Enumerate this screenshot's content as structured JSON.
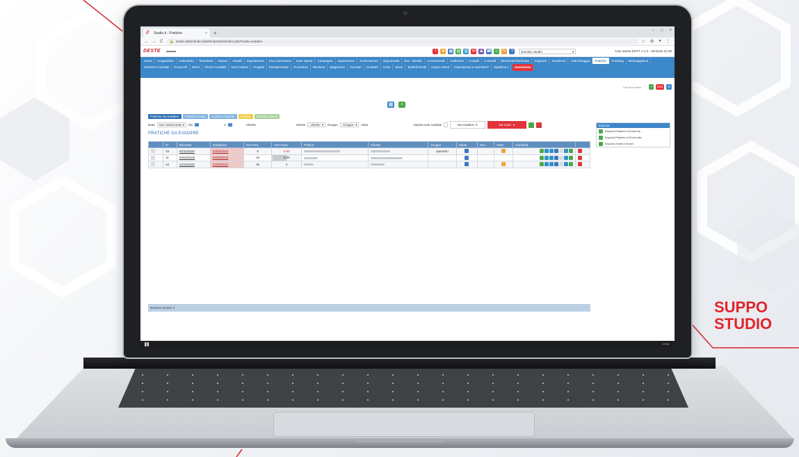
{
  "promo": {
    "text": "SUPPO\nSTUDIO",
    "accent": "#e3242b"
  },
  "browser": {
    "tab_title": "Studio.it - Pratiche",
    "url": "studio.dottorstudio.it/admin/pratiche/index.php?mode=evadere",
    "new_tab": "+",
    "close": "×",
    "window_controls": [
      "–",
      "□",
      "×"
    ],
    "nav": [
      "←",
      "→",
      "C"
    ]
  },
  "app": {
    "logo": "DESTE",
    "domain_select": "Dominio Studio",
    "user_info": "Ciao utente   DOTT 1.1.0 - Versione 21.00"
  },
  "menu": {
    "items": [
      "Home",
      "Anagrafiche",
      "Calendario",
      "Timesheet",
      "Report",
      "Attività",
      "Impostazioni",
      "Doc.Commesse",
      "Note Spese",
      "Campagne",
      "Importazioni",
      "Archiviazione",
      "Opportunità",
      "Doc. Vendita",
      "Commerciale",
      "Collezioni",
      "Compiti",
      "Contratti",
      "Direzione/Telefonate",
      "Supporto",
      "Scadenze",
      "Antiriciclaggio",
      "Pratiche",
      "Ticketing",
      "Messaggistica",
      "Gestione Contratti",
      "Protocolli",
      "Stock",
      "Clienti Contabili",
      "Invio Fatture",
      "Progetti",
      "Entrate/Uscite",
      "Procedure",
      "Bacheca",
      "Magazzino",
      "Circolari",
      "Contratti",
      "Corsi",
      "Stock",
      "Modelli Email",
      "Import Utenti",
      "Importazioni e mail IMAP",
      "Spedizioni",
      "Assistenza"
    ],
    "active": "Pratiche",
    "red_item": "Assistenza",
    "search_placeholder": "Cerca in menu",
    "right_buttons": [
      "+",
      "Esci"
    ]
  },
  "subtabs": [
    "Pratiche Da Evadere",
    "Pratiche Evase",
    "Archivio Pratiche",
    "Notifica",
    "Pratiche Nuove"
  ],
  "filters": {
    "data_label": "Data",
    "data_select": "Non Selezionato",
    "da_label": "Da",
    "a_label": "A",
    "cliente_label": "Cliente",
    "utente_label": "Utente",
    "utente_select": "-Utente-",
    "gruppo_label": "Gruppo",
    "gruppo_select": "-Gruppo-",
    "nota_label": "Nota",
    "mostra_label": "Mostra solo scadute",
    "evase": "Da evadere: 3",
    "scadute": "Da scad.: 0"
  },
  "section_title": "PRATICHE DA EVADERE",
  "table": {
    "headers": [
      "",
      "N°",
      "Ricevuta",
      "Scadenza",
      "Ore Prev",
      "Ore Cons",
      "Pratica",
      "Cliente",
      "Gruppo",
      "Utenti",
      "Doc",
      "Note",
      "Comandi",
      ""
    ],
    "rows": [
      {
        "n": "16",
        "ricevuta": "02/11/2020",
        "scadenza": "22/03/2021",
        "ore_prev": "8",
        "ore_cons": "0.00",
        "gruppo": "operatori"
      },
      {
        "n": "11",
        "ricevuta": "04/03/2020",
        "scadenza": "30/05/2020",
        "ore_prev": "16",
        "ore_cons": "9.00",
        "gruppo": ""
      },
      {
        "n": "12",
        "ricevuta": "12/11/2020",
        "scadenza": "23/03/2021",
        "ore_prev": "36",
        "ore_cons": "0",
        "gruppo": ""
      }
    ]
  },
  "footer": "Numero record: 3",
  "sidebar": {
    "title": "Esporta",
    "items": [
      "Esporta Pratiche in Excel xls",
      "Esporta Pratiche in Excel xlsx",
      "Esporta Ordini in Excel"
    ]
  },
  "taskbar": {
    "clock": "17:53"
  }
}
